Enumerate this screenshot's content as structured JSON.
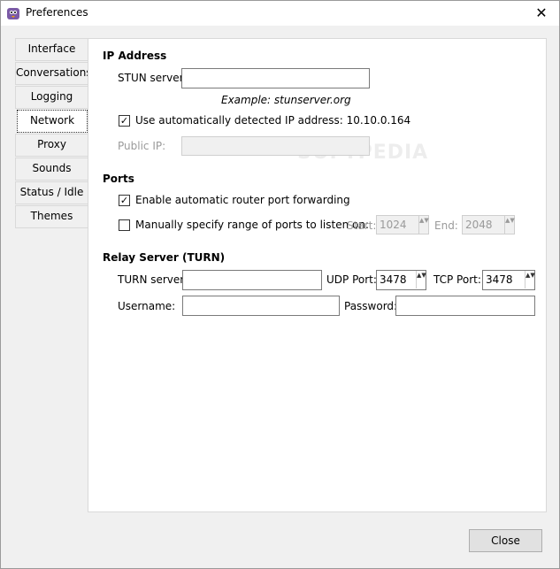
{
  "window": {
    "title": "Preferences",
    "close_glyph": "✕",
    "app_icon": "pidgin-icon"
  },
  "tabs": [
    {
      "label": "Interface"
    },
    {
      "label": "Conversations"
    },
    {
      "label": "Logging"
    },
    {
      "label": "Network"
    },
    {
      "label": "Proxy"
    },
    {
      "label": "Sounds"
    },
    {
      "label": "Status / Idle"
    },
    {
      "label": "Themes"
    }
  ],
  "active_tab": "Network",
  "ip": {
    "heading": "IP Address",
    "stun_label": "STUN server:",
    "stun_value": "",
    "example": "Example: stunserver.org",
    "auto_detect_label": "Use automatically detected IP address: 10.10.0.164",
    "auto_detect_checked": true,
    "public_ip_label": "Public IP:",
    "public_ip_value": ""
  },
  "ports": {
    "heading": "Ports",
    "auto_forward_label": "Enable automatic router port forwarding",
    "auto_forward_checked": true,
    "manual_label": "Manually specify range of ports to listen on:",
    "manual_checked": false,
    "start_label": "Start:",
    "start_value": "1024",
    "end_label": "End:",
    "end_value": "2048"
  },
  "relay": {
    "heading": "Relay Server (TURN)",
    "turn_label": "TURN server:",
    "turn_value": "",
    "udp_label": "UDP Port:",
    "udp_value": "3478",
    "tcp_label": "TCP Port:",
    "tcp_value": "3478",
    "username_label": "Username:",
    "username_value": "",
    "password_label": "Password:",
    "password_value": ""
  },
  "footer": {
    "close_label": "Close"
  },
  "watermark": "SOFTPEDIA",
  "checkmark": "✓",
  "spin_glyph": "▲▼"
}
